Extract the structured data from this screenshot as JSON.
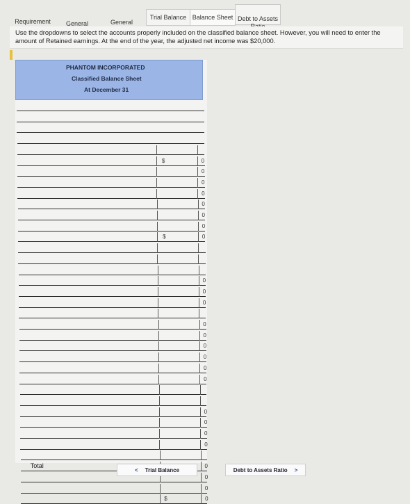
{
  "tabs": [
    {
      "label": "Requirement"
    },
    {
      "label": "General\nJournal"
    },
    {
      "label": "General\nLedger"
    },
    {
      "label": "Trial Balance"
    },
    {
      "label": "Balance Sheet"
    },
    {
      "label": "Debt to Assets\nRatio"
    }
  ],
  "instructions": "Use the dropdowns to select the accounts properly included on the classified balance sheet. However, you will need to enter the amount of Retained earnings. At the end of the year, the adjusted net income was $20,000.",
  "sheet": {
    "company": "PHANTOM INCORPORATED",
    "title": "Classified Balance Sheet",
    "date": "At December 31",
    "currency_symbol": "$",
    "zero": "0",
    "total_label": "Total"
  },
  "nav": {
    "prev_label": "Trial Balance",
    "next_label": "Debt to Assets Ratio",
    "prev_chevron": "<",
    "next_chevron": ">"
  }
}
